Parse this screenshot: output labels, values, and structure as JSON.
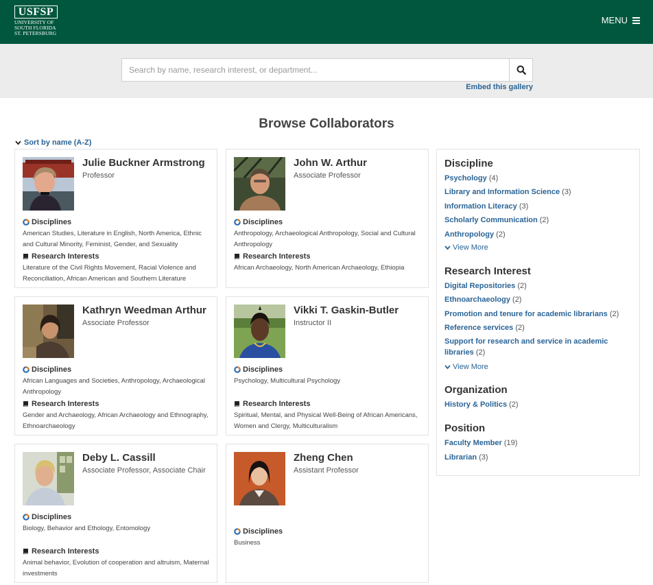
{
  "header": {
    "logo_mark": "USFSP",
    "logo_lines": [
      "UNIVERSITY OF",
      "SOUTH FLORIDA",
      "ST. PETERSBURG"
    ],
    "menu_label": "MENU",
    "background": "#00573d"
  },
  "search": {
    "placeholder": "Search by name, research interest, or department...",
    "button_icon": "search-icon",
    "embed_link": "Embed this gallery"
  },
  "page": {
    "title": "Browse Collaborators",
    "sort_label": "Sort by name (A-Z)"
  },
  "labels": {
    "disciplines": "Disciplines",
    "research_interests": "Research Interests"
  },
  "profiles": [
    {
      "name": "Julie Buckner Armstrong",
      "title": "Professor",
      "disciplines": "American Studies, Literature in English, North America, Ethnic and Cultural Minority, Feminist, Gender, and Sexuality",
      "research_interests": "Literature of the Civil Rights Movement, Racial Violence and Reconciliation, African American and Southern Literature"
    },
    {
      "name": "John W. Arthur",
      "title": "Associate Professor",
      "disciplines": "Anthropology, Archaeological Anthropology, Social and Cultural Anthropology",
      "research_interests": "African Archaeology, North American Archaeology, Ethiopia"
    },
    {
      "name": "Kathryn Weedman Arthur",
      "title": "Associate Professor",
      "disciplines": "African Languages and Societies, Anthropology, Archaeological Anthropology",
      "research_interests": "Gender and Archaeology, African Archaeology and Ethnography, Ethnoarchaeology"
    },
    {
      "name": "Vikki T. Gaskin-Butler",
      "title": "Instructor II",
      "disciplines": "Psychology, Multicultural Psychology",
      "research_interests": "Spiritual, Mental, and Physical Well-Being of African Americans, Women and Clergy, Multiculturalism"
    },
    {
      "name": "Deby L. Cassill",
      "title": "Associate Professor, Associate Chair",
      "disciplines": "Biology, Behavior and Ethology, Entomology",
      "research_interests": "Animal behavior, Evolution of cooperation and altruism, Maternal investments"
    },
    {
      "name": "Zheng Chen",
      "title": "Assistant Professor",
      "disciplines": "Business"
    }
  ],
  "facets": {
    "view_more": "View More",
    "discipline": {
      "title": "Discipline",
      "items": [
        {
          "label": "Psychology",
          "count": "(4)"
        },
        {
          "label": "Library and Information Science",
          "count": "(3)"
        },
        {
          "label": "Information Literacy",
          "count": "(3)"
        },
        {
          "label": "Scholarly Communication",
          "count": "(2)"
        },
        {
          "label": "Anthropology",
          "count": "(2)"
        }
      ]
    },
    "research_interest": {
      "title": "Research Interest",
      "items": [
        {
          "label": "Digital Repositories",
          "count": "(2)"
        },
        {
          "label": "Ethnoarchaeology",
          "count": "(2)"
        },
        {
          "label": "Promotion and tenure for academic librarians",
          "count": "(2)"
        },
        {
          "label": "Reference services",
          "count": "(2)"
        },
        {
          "label": "Support for research and service in academic libraries",
          "count": "(2)"
        }
      ]
    },
    "organization": {
      "title": "Organization",
      "items": [
        {
          "label": "History & Politics",
          "count": "(2)"
        }
      ]
    },
    "position": {
      "title": "Position",
      "items": [
        {
          "label": "Faculty Member",
          "count": "(19)"
        },
        {
          "label": "Librarian",
          "count": "(3)"
        }
      ]
    }
  }
}
